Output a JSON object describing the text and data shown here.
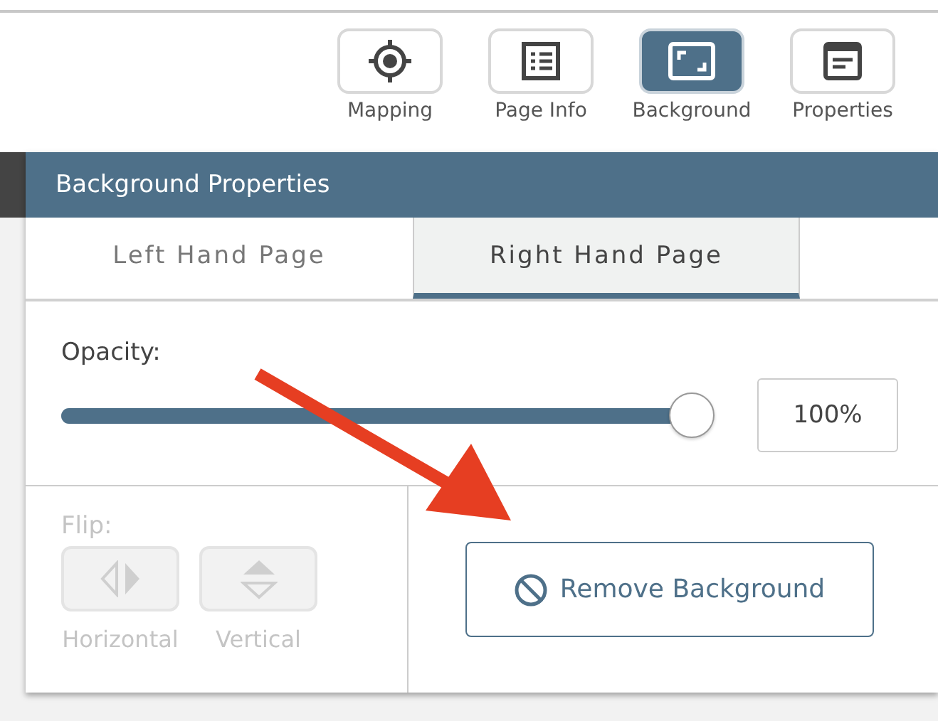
{
  "toolbar": [
    {
      "kind": "mapping",
      "label": "Mapping",
      "selected": false
    },
    {
      "kind": "page-info",
      "label": "Page Info",
      "selected": false
    },
    {
      "kind": "background",
      "label": "Background",
      "selected": true
    },
    {
      "kind": "properties",
      "label": "Properties",
      "selected": false
    }
  ],
  "panel": {
    "title": "Background Properties",
    "tabs": [
      {
        "label": "Left Hand Page",
        "selected": false
      },
      {
        "label": "Right Hand Page",
        "selected": true
      }
    ],
    "opacity": {
      "label": "Opacity:",
      "level": 1,
      "value": "100%"
    },
    "flip": {
      "label": "Flip:",
      "buttons": [
        {
          "kind": "horizontal",
          "label": "Horizontal",
          "disabled": true
        },
        {
          "kind": "vertical",
          "label": "Vertical",
          "disabled": true
        }
      ]
    },
    "remove_button": "Remove Background"
  }
}
